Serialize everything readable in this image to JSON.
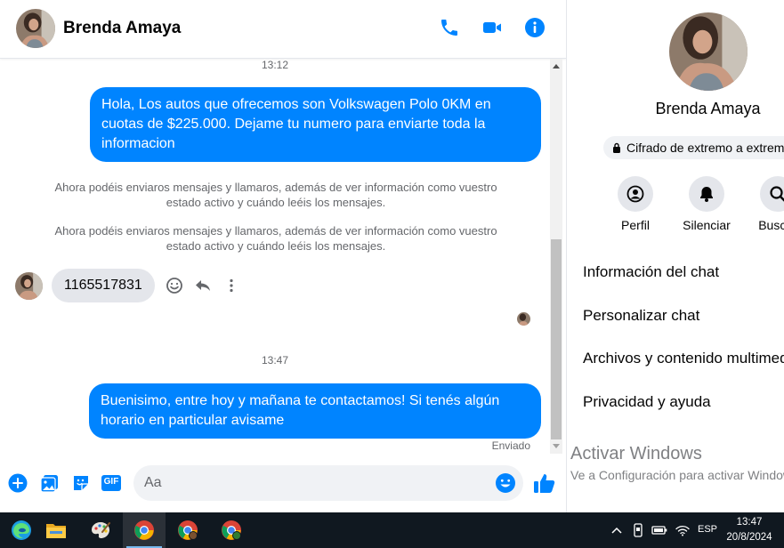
{
  "contact": {
    "name": "Brenda Amaya"
  },
  "header": {
    "icons": {
      "call": "phone-icon",
      "video": "video-icon",
      "info": "info-icon"
    }
  },
  "messages": {
    "timestamp_1": "13:12",
    "outgoing_1": "Hola, Los autos que ofrecemos son Volkswagen Polo 0KM en cuotas de $225.000. Dejame tu numero para enviarte toda la informacion",
    "system_1": "Ahora podéis enviaros mensajes y llamaros, además de ver información como vuestro estado activo y cuándo leéis los mensajes.",
    "system_2": "Ahora podéis enviaros mensajes y llamaros, además de ver información como vuestro estado activo y cuándo leéis los mensajes.",
    "incoming_1": "1165517831",
    "timestamp_2": "13:47",
    "outgoing_2": "Buenisimo, entre hoy y mañana te contactamos! Si tenés algún horario en particular avisame",
    "status": "Enviado"
  },
  "composer": {
    "placeholder": "Aa",
    "gif_label": "GIF"
  },
  "panel": {
    "name": "Brenda Amaya",
    "encryption": "Cifrado de extremo a extremo",
    "actions": [
      {
        "label": "Perfil",
        "icon": "profile-icon"
      },
      {
        "label": "Silenciar",
        "icon": "bell-icon"
      },
      {
        "label": "Buscar",
        "icon": "search-icon"
      }
    ],
    "menu": [
      "Información del chat",
      "Personalizar chat",
      "Archivos y contenido multimedia",
      "Privacidad y ayuda"
    ]
  },
  "watermark": {
    "title": "Activar Windows",
    "subtitle": "Ve a Configuración para activar Windows."
  },
  "taskbar": {
    "language": "ESP",
    "time": "13:47",
    "date": "20/8/2024"
  },
  "colors": {
    "accent": "#0084ff",
    "incoming_bubble": "#e4e6eb",
    "taskbar": "#101820"
  }
}
